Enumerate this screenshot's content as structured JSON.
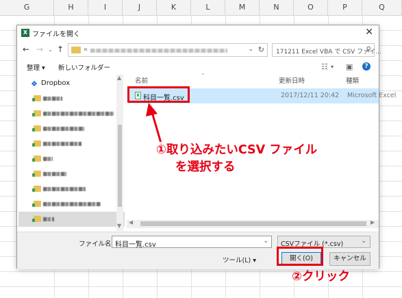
{
  "sheet": {
    "columns": [
      "G",
      "H",
      "I",
      "J",
      "K",
      "L",
      "M",
      "N",
      "O",
      "P",
      "Q"
    ]
  },
  "dialog": {
    "title": "ファイルを開く",
    "title_icon_letter": "X",
    "search_placeholder": "171211 Excel VBA で CSV ファイ...",
    "toolbar": {
      "organize": "整理 ▾",
      "new_folder": "新しいフォルダー"
    },
    "columns": {
      "name": "名前",
      "date": "更新日時",
      "type": "種類"
    },
    "sidebar": {
      "dropbox": "Dropbox"
    },
    "files": [
      {
        "name": "科目一覧.csv",
        "date": "2017/12/11 20:42",
        "type": "Microsoft Excel"
      }
    ],
    "file_name_label": "ファイル名(N):",
    "file_name_value": "科目一覧.csv",
    "file_type_value": "CSVファイル (*.csv)",
    "tools_label": "ツール(L)",
    "open_button": "開く(O)",
    "cancel_button": "キャンセル"
  },
  "annotations": {
    "step1_line1": "①取り込みたいCSV ファイル",
    "step1_line2": "を選択する",
    "step2": "②クリック"
  },
  "colors": {
    "annotation_red": "#e60012",
    "selection_blue": "#cce8ff"
  }
}
